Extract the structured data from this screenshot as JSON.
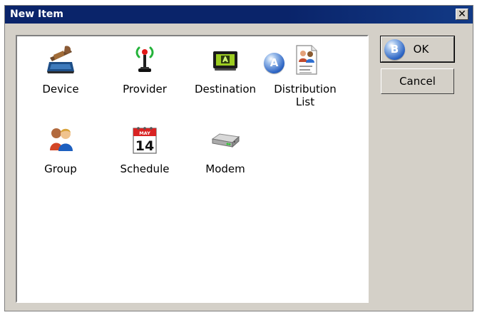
{
  "window": {
    "title": "New Item",
    "close_symbol": "✕"
  },
  "items": [
    {
      "label": "Device",
      "icon": "laptop-icon"
    },
    {
      "label": "Provider",
      "icon": "antenna-icon"
    },
    {
      "label": "Destination",
      "icon": "monitor-icon"
    },
    {
      "label": "Distribution\nList",
      "icon": "address-list-icon"
    },
    {
      "label": "Group",
      "icon": "group-icon"
    },
    {
      "label": "Schedule",
      "icon": "calendar-icon"
    },
    {
      "label": "Modem",
      "icon": "modem-icon"
    }
  ],
  "calendar": {
    "month": "MAY",
    "day": "14"
  },
  "buttons": {
    "ok_label": "OK",
    "cancel_label": "Cancel"
  },
  "markers": {
    "a": "A",
    "b": "B"
  },
  "colors": {
    "title_bar": "#0a246a",
    "window_bg": "#d4d0c8",
    "panel_bg": "#ffffff",
    "marker_blue": "#2d65c4"
  }
}
